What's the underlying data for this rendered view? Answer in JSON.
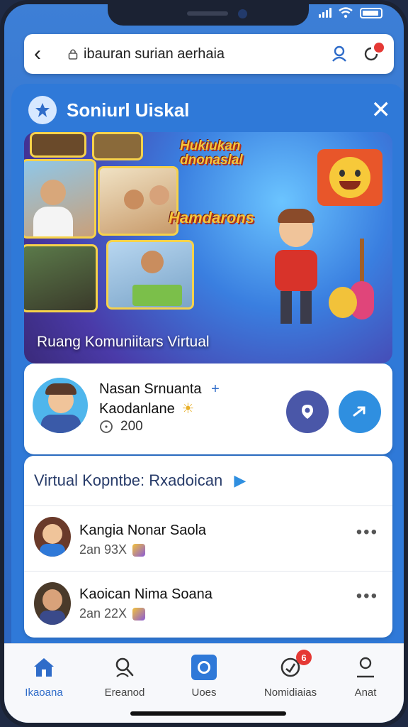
{
  "browser": {
    "url": "ibauran surian aerhaia"
  },
  "panel": {
    "title": "Soniurl Uiskal"
  },
  "hero": {
    "caption": "Ruang Komuniitars Virtual",
    "badge_top": "Hukiukan dnonaslal",
    "badge_mid": "Hamdarons"
  },
  "profile": {
    "name_line1": "Nasan Srnuanta",
    "name_line2": "Kaodanlane",
    "count": "200"
  },
  "list": {
    "heading": "Virtual Kopntbe: Rxadoican",
    "rows": [
      {
        "name": "Kangia Nonar Saola",
        "sub": "2an 93X"
      },
      {
        "name": "Kaoican Nima Soana",
        "sub": "2an 22X"
      }
    ]
  },
  "tabs": [
    {
      "label": "Ikaoana"
    },
    {
      "label": "Ereanod"
    },
    {
      "label": "Uoes"
    },
    {
      "label": "Nomidiaias",
      "badge": "6"
    },
    {
      "label": "Anat"
    }
  ],
  "colors": {
    "accent": "#2f6cc9",
    "panel": "#2f79d8",
    "badge_red": "#e53935",
    "action_purple": "#4a57a8",
    "action_blue": "#2f8fe0"
  }
}
